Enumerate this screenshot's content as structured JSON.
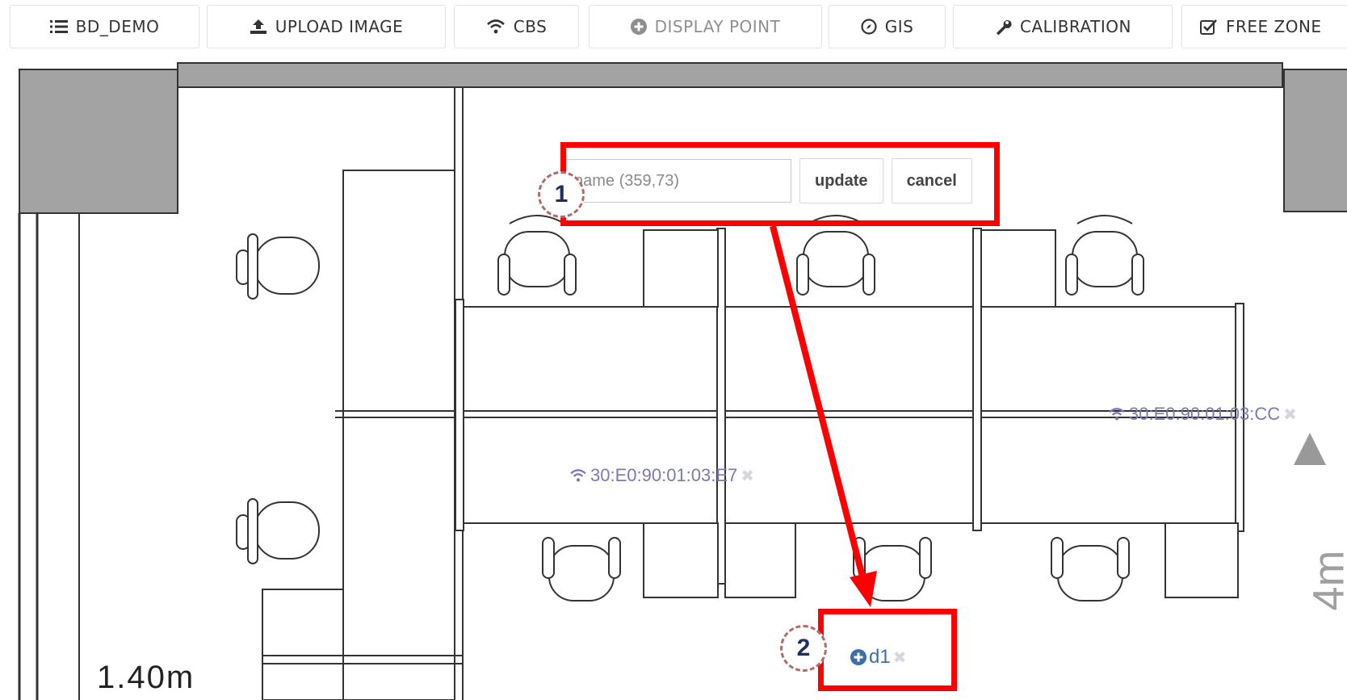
{
  "toolbar": {
    "items": [
      {
        "label": "BD_DEMO",
        "icon": "list-icon"
      },
      {
        "label": "UPLOAD IMAGE",
        "icon": "upload-icon"
      },
      {
        "label": "CBS",
        "icon": "wifi-icon"
      },
      {
        "label": "DISPLAY POINT",
        "icon": "plus-circle-icon"
      },
      {
        "label": "GIS",
        "icon": "compass-icon"
      },
      {
        "label": "CALIBRATION",
        "icon": "wrench-icon"
      },
      {
        "label": "FREE ZONE",
        "icon": "checkbox-icon"
      }
    ]
  },
  "edit_popup": {
    "placeholder": "name (359,73)",
    "update_label": "update",
    "cancel_label": "cancel"
  },
  "access_points": [
    {
      "label": "30:E0:90:01:03:E7",
      "icon": "wifi-icon"
    },
    {
      "label": "30:E0:90:01:03:CC",
      "icon": "wifi-icon"
    }
  ],
  "point": {
    "label": "d1",
    "icon": "plus-circle-icon"
  },
  "scale": {
    "horizontal": "1.40m",
    "vertical": "4m"
  },
  "annotations": {
    "step_1": "1",
    "step_2": "2"
  },
  "colors": {
    "highlight": "#ff0000",
    "ap_label": "#7b78b8",
    "point_label": "#3c6fa8",
    "wall_fill": "#a0a0a0"
  }
}
